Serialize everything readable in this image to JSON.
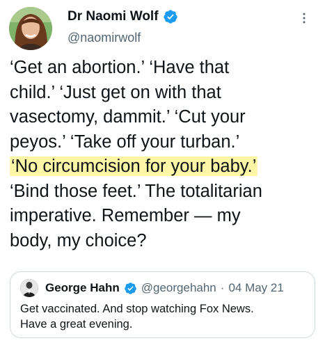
{
  "tweet": {
    "author": {
      "display_name": "Dr Naomi Wolf",
      "handle": "@naomirwolf",
      "verified": true,
      "avatar_icon": "profile-photo-icon"
    },
    "text_lines": [
      "‘Get an abortion.’ ‘Have that",
      "child.’ ‘Just get on with that",
      "vasectomy, dammit.’ ‘Cut your",
      "peyos.’ ‘Take off your turban.’",
      "‘No circumcision for your baby.’",
      "‘Bind those feet.’ The totalitarian",
      "imperative. Remember — my",
      "body, my choice?"
    ],
    "highlighted_line": "‘No circumcision for your baby.’",
    "more_icon": "more-options-icon"
  },
  "quote": {
    "author": {
      "display_name": "George Hahn",
      "handle": "@georgehahn",
      "separator": "·",
      "date": "04 May 21",
      "verified": true
    },
    "text_lines": [
      "Get vaccinated. And stop watching Fox News.",
      "Have a great evening."
    ]
  },
  "colors": {
    "text": "#0f1419",
    "secondary": "#536471",
    "verified": "#1d9bf0",
    "highlight": "#fdf6a6",
    "border": "#cfd9de"
  }
}
